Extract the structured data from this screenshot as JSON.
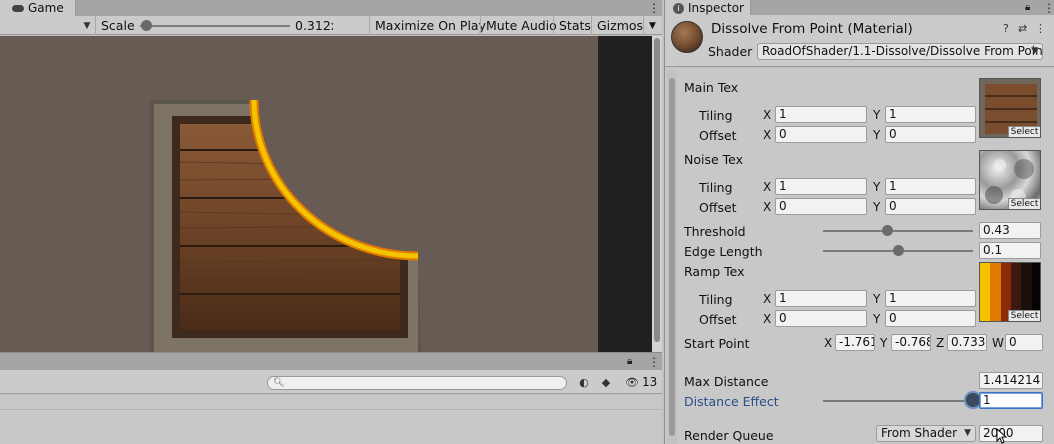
{
  "game": {
    "tab_label": "Game",
    "toolbar": {
      "scale_label": "Scale",
      "scale_value": "0.312x",
      "scale_fraction": 0.04,
      "maximize": "Maximize On Play",
      "mute": "Mute Audio",
      "stats": "Stats",
      "gizmos": "Gizmos"
    }
  },
  "project": {
    "search_placeholder": "",
    "hidden_count": "13"
  },
  "inspector": {
    "tab_label": "Inspector",
    "title": "Dissolve From Point (Material)",
    "shader_label": "Shader",
    "shader_value": "RoadOfShader/1.1-Dissolve/Dissolve From Point",
    "main_tex": {
      "label": "Main Tex",
      "tiling_x": "1",
      "tiling_y": "1",
      "offset_x": "0",
      "offset_y": "0"
    },
    "noise_tex": {
      "label": "Noise Tex",
      "tiling_x": "1",
      "tiling_y": "1",
      "offset_x": "0",
      "offset_y": "0"
    },
    "ramp_tex": {
      "label": "Ramp Tex",
      "tiling_x": "1",
      "tiling_y": "1",
      "offset_x": "0",
      "offset_y": "0"
    },
    "tiling_label": "Tiling",
    "offset_label": "Offset",
    "x_label": "X",
    "y_label": "Y",
    "z_label": "Z",
    "w_label": "W",
    "select_label": "Select",
    "threshold": {
      "label": "Threshold",
      "value": "0.43",
      "fraction": 0.43
    },
    "edge_length": {
      "label": "Edge Length",
      "value": "0.1",
      "fraction": 0.5
    },
    "start_point": {
      "label": "Start Point",
      "x": "-1.761",
      "y": "-0.768",
      "z": "0.733",
      "w": "0"
    },
    "max_distance": {
      "label": "Max Distance",
      "value": "1.414214"
    },
    "distance_effect": {
      "label": "Distance Effect",
      "value": "1",
      "fraction": 1.0
    },
    "render_queue": {
      "label": "Render Queue",
      "mode": "From Shader",
      "value": "2000"
    }
  },
  "colors": {
    "viewport_bg": "#685b54",
    "ramp": [
      "#f5c400",
      "#e07a00",
      "#8a2a0a",
      "#3c1a10",
      "#1a0f0c",
      "#050303"
    ],
    "edge_glow": "#f2a800"
  }
}
